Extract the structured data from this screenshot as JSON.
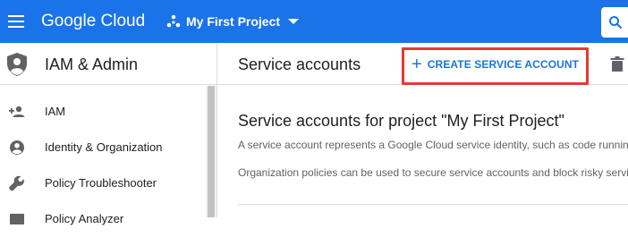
{
  "topbar": {
    "brand": "Google Cloud",
    "project_name": "My First Project",
    "bg_color": "#1a73e8"
  },
  "icons": {
    "menu": "hamburger-menu-icon",
    "project": "project-dots-icon",
    "dropdown": "caret-down-icon",
    "search": "search-icon",
    "section": "shield-person-icon",
    "trash": "trash-icon"
  },
  "sidebar": {
    "title": "IAM & Admin",
    "items": [
      {
        "label": "IAM",
        "icon": "person-add-icon"
      },
      {
        "label": "Identity & Organization",
        "icon": "account-circle-icon"
      },
      {
        "label": "Policy Troubleshooter",
        "icon": "wrench-icon"
      },
      {
        "label": "Policy Analyzer",
        "icon": "analyzer-icon"
      }
    ]
  },
  "main": {
    "page_title": "Service accounts",
    "create_label": "CREATE SERVICE ACCOUNT",
    "section_title": "Service accounts for project \"My First Project\"",
    "desc1": "A service account represents a Google Cloud service identity, such as code running",
    "desc2": "Organization policies can be used to secure service accounts and block risky servi"
  },
  "colors": {
    "accent": "#1a73e8",
    "highlight": "#e53935",
    "text": "#202124",
    "muted": "#5f6368"
  }
}
